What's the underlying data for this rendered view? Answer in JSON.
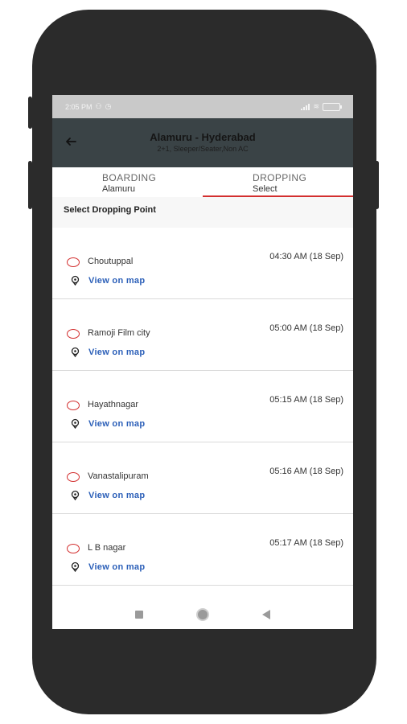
{
  "status": {
    "time": "2:05 PM"
  },
  "header": {
    "title": "Alamuru - Hyderabad",
    "subtitle": "2+1, Sleeper/Seater,Non AC"
  },
  "tabs": [
    {
      "label": "BOARDING",
      "value": "Alamuru",
      "active": false
    },
    {
      "label": "DROPPING",
      "value": "Select",
      "active": true
    }
  ],
  "section": {
    "title": "Select Dropping Point"
  },
  "points": [
    {
      "name": "Choutuppal",
      "time": "04:30 AM (18 Sep)",
      "link": "View on map"
    },
    {
      "name": "Ramoji Film city",
      "time": "05:00 AM (18 Sep)",
      "link": "View on map"
    },
    {
      "name": "Hayathnagar",
      "time": "05:15 AM (18 Sep)",
      "link": "View on map"
    },
    {
      "name": "Vanastalipuram",
      "time": "05:16 AM (18 Sep)",
      "link": "View on map"
    },
    {
      "name": "L B nagar",
      "time": "05:17 AM (18 Sep)",
      "link": "View on map"
    }
  ],
  "colors": {
    "accent": "#d32f2f",
    "link": "#2b5fb8",
    "appbar": "#3a4346"
  },
  "icons": [
    "back-arrow-icon",
    "radio-icon",
    "location-pin-icon",
    "recents-icon",
    "home-icon",
    "back-nav-icon"
  ]
}
